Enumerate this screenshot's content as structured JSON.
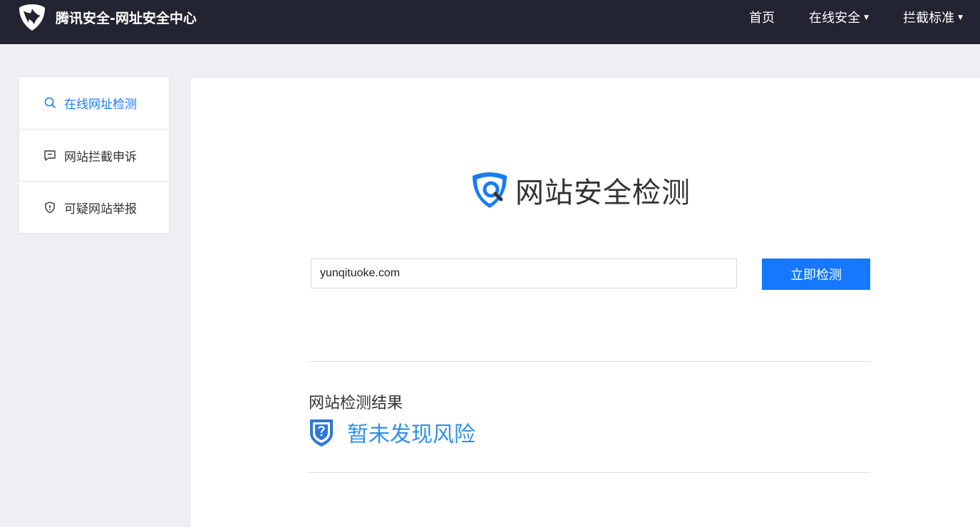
{
  "header": {
    "brand_title": "腾讯安全-网址安全中心",
    "nav": {
      "home": "首页",
      "online_security": "在线安全",
      "block_standard": "拦截标准"
    }
  },
  "sidebar": {
    "items": [
      {
        "label": "在线网址检测",
        "icon": "search-icon",
        "active": true
      },
      {
        "label": "网站拦截申诉",
        "icon": "message-icon",
        "active": false
      },
      {
        "label": "可疑网站举报",
        "icon": "shield-alert-icon",
        "active": false
      }
    ]
  },
  "main": {
    "hero_title": "网站安全检测",
    "url_input": {
      "value": "yunqituoke.com"
    },
    "check_button": "立即检测",
    "result_title": "网站检测结果",
    "result_text": "暂未发现风险"
  },
  "colors": {
    "topbar": "#222432",
    "accent": "#1677ff",
    "result": "#2f8fe8",
    "page_bg": "#efeff3"
  }
}
